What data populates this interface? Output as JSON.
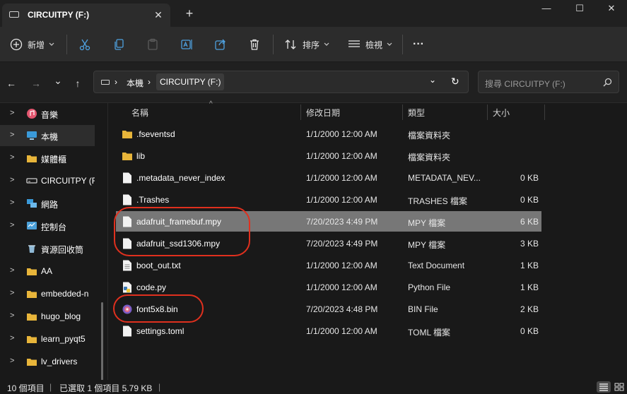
{
  "window": {
    "tab_title": "CIRCUITPY (F:)",
    "tab_close": "✕",
    "new_tab": "+",
    "minimize": "—",
    "maximize": "☐",
    "close": "✕"
  },
  "toolbar": {
    "new_label": "新增",
    "sort_label": "排序",
    "view_label": "檢視",
    "more": "···"
  },
  "nav": {
    "back": "←",
    "forward": "→",
    "history": "⌄",
    "up": "↑"
  },
  "address": {
    "crumbs": [
      "本機",
      "CIRCUITPY (F:)"
    ],
    "dropdown": "⌄",
    "refresh": "↻",
    "search_placeholder": "搜尋 CIRCUITPY (F:)"
  },
  "sidebar": {
    "items": [
      {
        "label": "音樂",
        "icon": "music-icon",
        "expandable": true
      },
      {
        "label": "本機",
        "icon": "computer-icon",
        "expandable": true,
        "selected": true
      },
      {
        "label": "媒體櫃",
        "icon": "folder-icon",
        "expandable": true
      },
      {
        "label": "CIRCUITPY (F:)",
        "icon": "drive-icon",
        "expandable": true
      },
      {
        "label": "網路",
        "icon": "network-icon",
        "expandable": true
      },
      {
        "label": "控制台",
        "icon": "control-panel-icon",
        "expandable": true
      },
      {
        "label": "資源回收筒",
        "icon": "recycle-bin-icon",
        "expandable": false
      },
      {
        "label": "AA",
        "icon": "folder-icon",
        "expandable": true
      },
      {
        "label": "embedded-n",
        "icon": "folder-icon",
        "expandable": true
      },
      {
        "label": "hugo_blog",
        "icon": "folder-icon",
        "expandable": true
      },
      {
        "label": "learn_pyqt5",
        "icon": "folder-icon",
        "expandable": true
      },
      {
        "label": "lv_drivers",
        "icon": "folder-icon",
        "expandable": true
      }
    ]
  },
  "columns": {
    "name": "名稱",
    "modified": "修改日期",
    "type": "類型",
    "size": "大小",
    "sort_indicator": "^"
  },
  "files": [
    {
      "name": ".fseventsd",
      "modified": "1/1/2000 12:00 AM",
      "type": "檔案資料夾",
      "size": "",
      "icon": "folder-icon"
    },
    {
      "name": "lib",
      "modified": "1/1/2000 12:00 AM",
      "type": "檔案資料夾",
      "size": "",
      "icon": "folder-icon"
    },
    {
      "name": ".metadata_never_index",
      "modified": "1/1/2000 12:00 AM",
      "type": "METADATA_NEV...",
      "size": "0 KB",
      "icon": "file-icon"
    },
    {
      "name": ".Trashes",
      "modified": "1/1/2000 12:00 AM",
      "type": "TRASHES 檔案",
      "size": "0 KB",
      "icon": "file-icon"
    },
    {
      "name": "adafruit_framebuf.mpy",
      "modified": "7/20/2023 4:49 PM",
      "type": "MPY 檔案",
      "size": "6 KB",
      "icon": "file-icon",
      "selected": true
    },
    {
      "name": "adafruit_ssd1306.mpy",
      "modified": "7/20/2023 4:49 PM",
      "type": "MPY 檔案",
      "size": "3 KB",
      "icon": "file-icon"
    },
    {
      "name": "boot_out.txt",
      "modified": "1/1/2000 12:00 AM",
      "type": "Text Document",
      "size": "1 KB",
      "icon": "text-file-icon"
    },
    {
      "name": "code.py",
      "modified": "1/1/2000 12:00 AM",
      "type": "Python File",
      "size": "1 KB",
      "icon": "python-file-icon"
    },
    {
      "name": "font5x8.bin",
      "modified": "7/20/2023 4:48 PM",
      "type": "BIN File",
      "size": "2 KB",
      "icon": "bin-file-icon"
    },
    {
      "name": "settings.toml",
      "modified": "1/1/2000 12:00 AM",
      "type": "TOML 檔案",
      "size": "0 KB",
      "icon": "file-icon"
    }
  ],
  "status": {
    "count": "10 個項目",
    "selected": "已選取 1 個項目  5.79 KB"
  },
  "colors": {
    "background": "#191919",
    "selection": "#777777",
    "annotation": "#e0301e",
    "folder": "#e8b53a"
  }
}
